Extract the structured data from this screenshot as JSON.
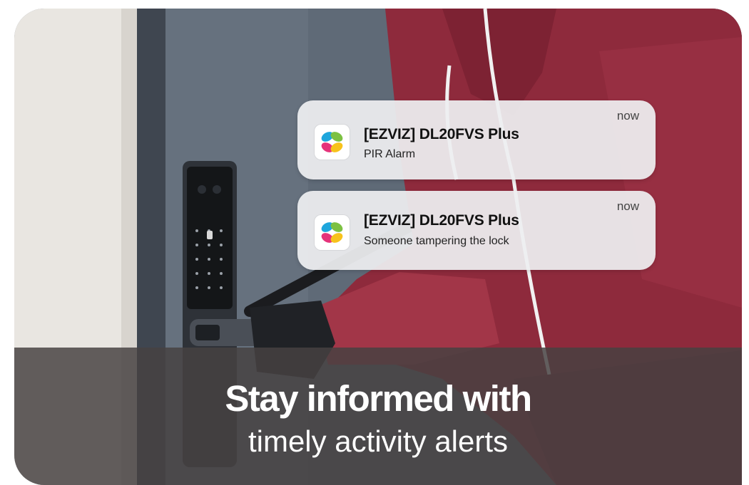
{
  "notifications": [
    {
      "app_icon": "ezviz-app-icon",
      "title": "[EZVIZ] DL20FVS Plus",
      "body": "PIR Alarm",
      "time": "now"
    },
    {
      "app_icon": "ezviz-app-icon",
      "title": "[EZVIZ] DL20FVS Plus",
      "body": "Someone tampering the lock",
      "time": "now"
    }
  ],
  "banner": {
    "headline": "Stay informed with",
    "subheadline": "timely activity alerts"
  },
  "colors": {
    "hoodie": "#8e2a3c",
    "door": "#636d79",
    "wall": "#e9e6e1",
    "banner_overlay": "#464242",
    "notification_bg": "#eeeff1"
  }
}
